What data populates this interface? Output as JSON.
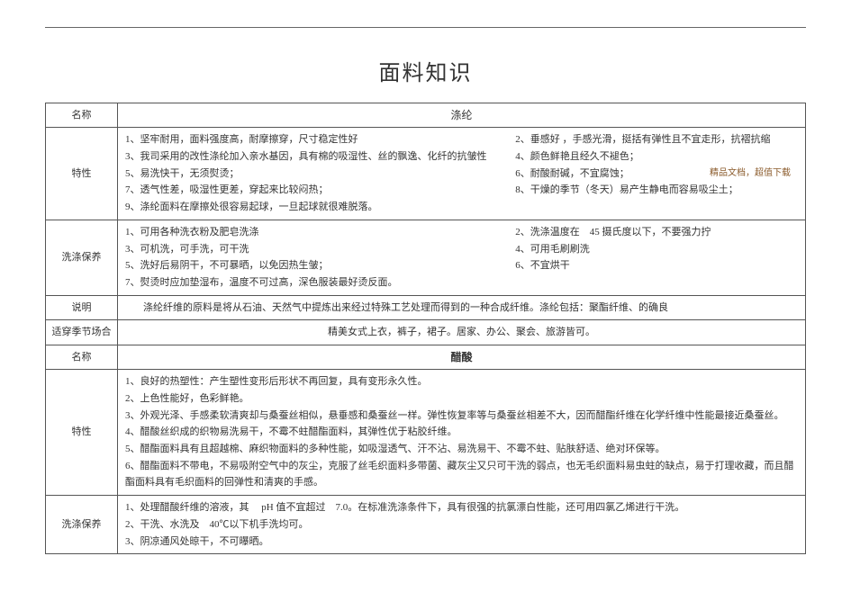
{
  "title": "面料知识",
  "labels": {
    "name": "名称",
    "feature": "特性",
    "care": "洗涤保养",
    "explain": "说明",
    "season": "适穿季节场合"
  },
  "fabric1": {
    "name": "涤纶",
    "features": {
      "l1a": "1、坚牢耐用，面料强度高，耐摩擦穿，尺寸稳定性好",
      "l1b": "2、垂感好 ，手感光滑，挺括有弹性且不宜走形，抗褶抗缩",
      "l2a": "3、我司采用的改性涤纶加入亲水基因，具有棉的吸湿性、丝的飘逸、化纤的抗皱性",
      "l2b": "4、颜色鲜艳且经久不褪色；",
      "l3a": "5、易洗快干，无须熨烫；",
      "l3b": "6、耐酸耐碱，不宜腐蚀；",
      "l3note": "精品文档，超值下载",
      "l4a": "7、透气性差，吸湿性更差，穿起来比较闷热；",
      "l4b": "8、干燥的季节（冬天）易产生静电而容易吸尘土；",
      "l5": "9、涤纶面料在摩擦处很容易起球，一旦起球就很难脱落。"
    },
    "care": {
      "l1a": "1、可用各种洗衣粉及肥皂洗涤",
      "l1b": "2、洗涤温度在　45 摄氏度以下，不要强力拧",
      "l2a": "3、可机洗，可手洗，可干洗",
      "l2b": "4、可用毛刷刷洗",
      "l3a": "5、洗好后易阴干，不可暴晒，以免因热生皱；",
      "l3b": "6、不宜烘干",
      "l4": "7、熨烫时应加垫湿布，温度不可过高，深色服装最好烫反面。"
    },
    "explain": "涤纶纤维的原料是将从石油、天然气中提炼出来经过特殊工艺处理而得到的一种合成纤维。涤纶包括：聚酯纤维、的确良",
    "season": "精美女式上衣，裤子，裙子。居家、办公、聚会、旅游皆可。"
  },
  "fabric2": {
    "name": "醋酸",
    "features": {
      "l1": "1、良好的热塑性：产生塑性变形后形状不再回复，具有变形永久性。",
      "l2": "2、上色性能好，色彩鲜艳。",
      "l3": "3、外观光泽、手感柔软清爽却与桑蚕丝相似，悬垂感和桑蚕丝一样。弹性恢复率等与桑蚕丝相差不大，因而醋酯纤维在化学纤维中性能最接近桑蚕丝。",
      "l4": "4、醋酸丝织成的织物易洗易干，不霉不蛀醋酯面料，其弹性优于粘胶纤维。",
      "l5": "5、醋酯面料具有且超越棉、麻织物面料的多种性能，如吸湿透气、汗不沾、易洗易干、不霉不蛀、贴肤舒适、绝对环保等。",
      "l6": "6、醋酯面料不带电，不易吸附空气中的灰尘，克服了丝毛织面料多带菌、藏灰尘又只可干洗的弱点，也无毛织面料易虫蛀的缺点，易于打理收藏，而且醋酯面料具有毛织面料的回弹性和清爽的手感。"
    },
    "care": {
      "l1": "1、处理醋酸纤维的溶液，其　 pH 值不宜超过　7.0。在标准洗涤条件下，具有很强的抗氯漂白性能，还可用四氯乙烯进行干洗。",
      "l2": "2、干洗、水洗及　40℃以下机手洗均可。",
      "l3": "3、阴凉通风处晾干，不可曝晒。"
    }
  }
}
